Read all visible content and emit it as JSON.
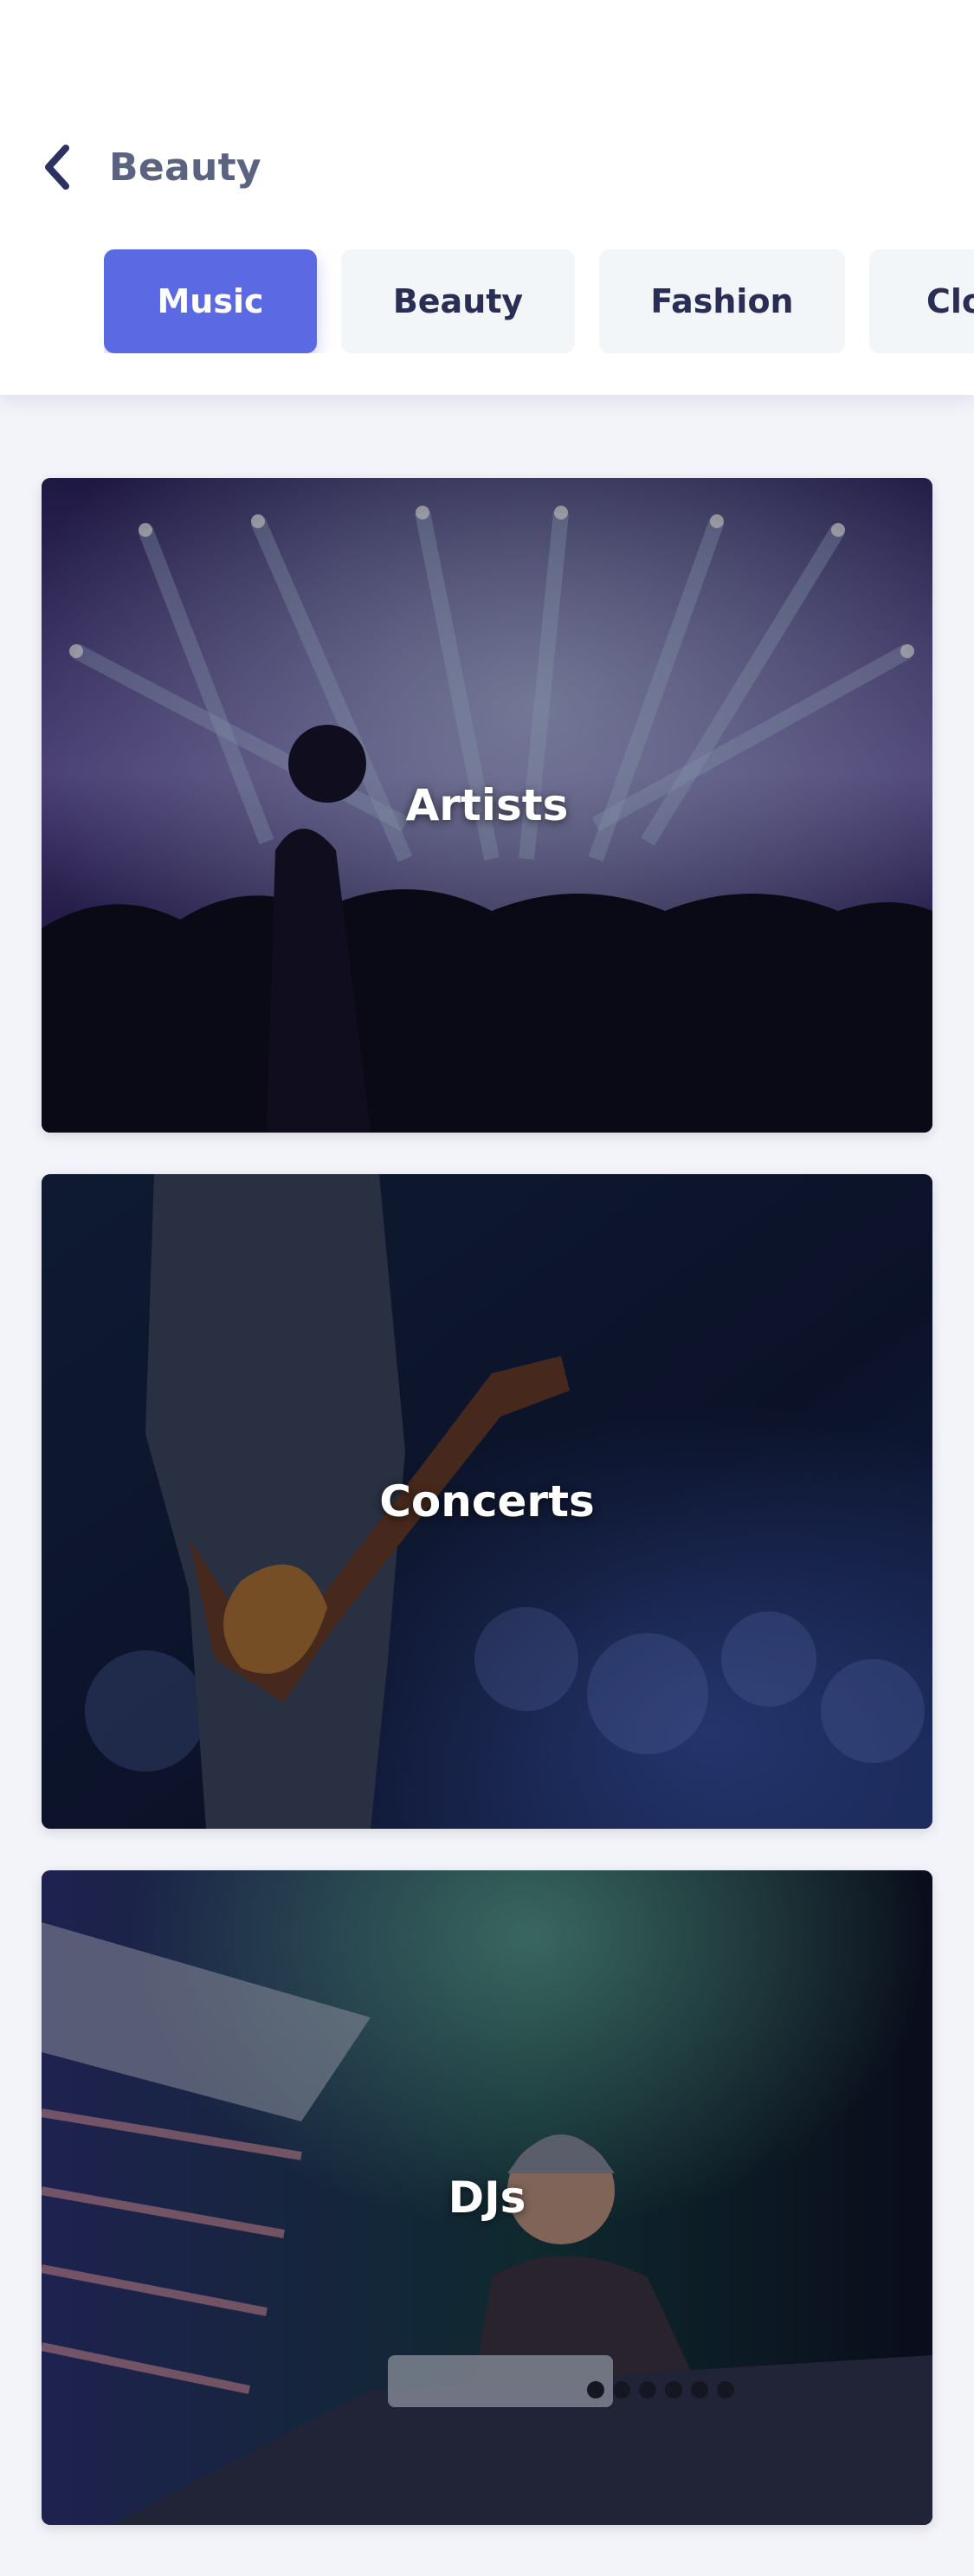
{
  "header": {
    "back_title": "Beauty",
    "back_icon": "chevron-left-icon"
  },
  "tabs": [
    {
      "label": "Music",
      "active": true
    },
    {
      "label": "Beauty",
      "active": false
    },
    {
      "label": "Fashion",
      "active": false
    },
    {
      "label": "Clo",
      "active": false
    }
  ],
  "cards": [
    {
      "label": "Artists"
    },
    {
      "label": "Concerts"
    },
    {
      "label": "DJs"
    }
  ],
  "colors": {
    "accent": "#5b6ae2",
    "tab_bg": "#f3f6f8",
    "tab_text": "#2a2e55",
    "page_bg": "#f2f4f9"
  }
}
